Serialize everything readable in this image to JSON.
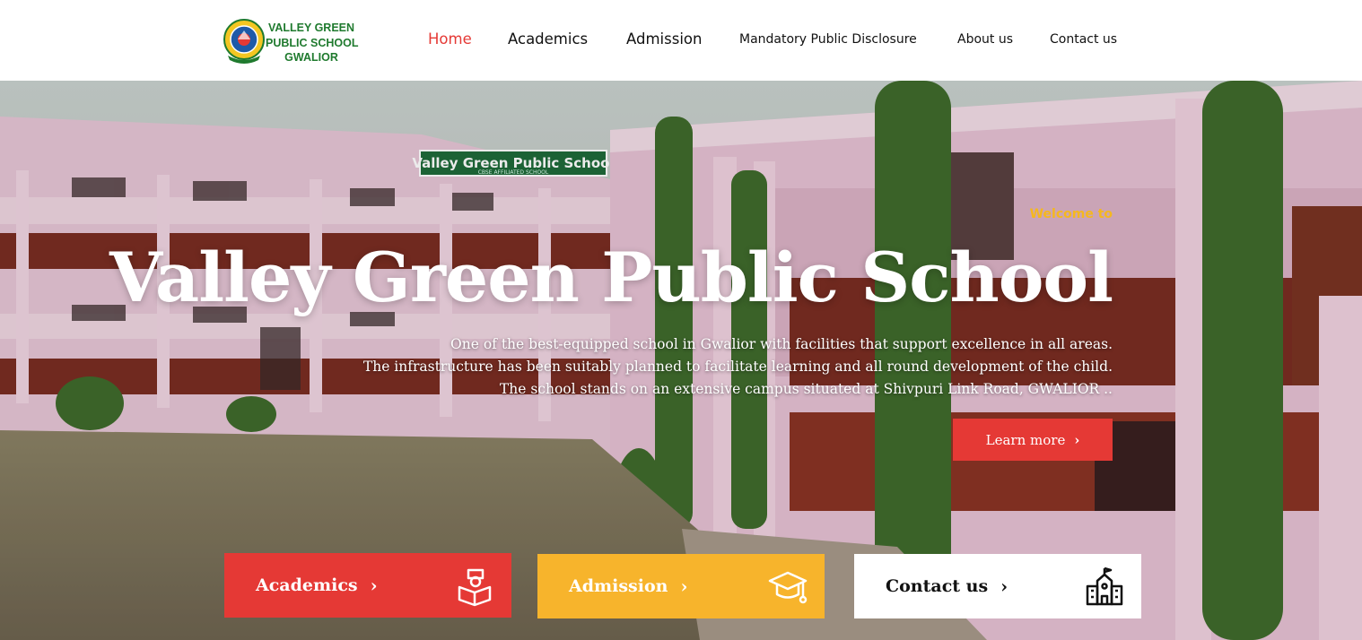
{
  "brand": {
    "line1": "VALLEY GREEN",
    "line2": "PUBLIC SCHOOL",
    "line3": "GWALIOR",
    "logo_icon": "school-emblem-icon"
  },
  "nav": [
    {
      "label": "Home",
      "active": true
    },
    {
      "label": "Academics"
    },
    {
      "label": "Admission"
    },
    {
      "label": "Mandatory Public Disclosure"
    },
    {
      "label": "About us"
    },
    {
      "label": "Contact us"
    }
  ],
  "hero": {
    "welcome": "Welcome to",
    "title": "Valley Green Public School",
    "desc1": "One of the best-equipped school in Gwalior with facilities that support excellence in all areas.",
    "desc2": "The infrastructure has been suitably planned to facilitate learning and all round development of the child.",
    "desc3": "The school stands on an extensive campus situated at Shivpuri Link Road, GWALIOR ..",
    "button": "Learn more",
    "sign": "Valley Green Public School",
    "sign_sub": "CBSE AFFILIATED SCHOOL"
  },
  "cards": [
    {
      "label": "Academics",
      "icon": "student-books-icon",
      "color": "#e53935"
    },
    {
      "label": "Admission",
      "icon": "graduation-cap-icon",
      "color": "#f7b42c"
    },
    {
      "label": "Contact us",
      "icon": "school-building-icon",
      "color": "#ffffff"
    }
  ],
  "colors": {
    "accent": "#e53935",
    "yellow": "#f7b42c",
    "brand_green": "#1f7a2e"
  }
}
